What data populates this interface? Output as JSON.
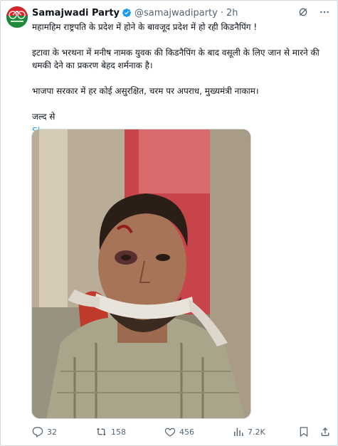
{
  "author": {
    "name": "Samajwadi Party",
    "handle": "@samajwadiparty",
    "separator": "·",
    "time": "2h",
    "avatar_icon": "samajwadi-cycle-logo",
    "verified_icon": "verified-badge-icon"
  },
  "tweet": {
    "line1": "महामहिम राष्ट्रपति के प्रदेश में होने के बावजूद प्रदेश में हो रही किडनैपिंग !",
    "line2": "इटावा के भरथना में मनीष नामक युवक की किडनैपिंग के बाद वसूली के लिए जान से मारने की धमकी देने का प्रकरण बेहद शर्मनाक है।",
    "line3": "भाजपा सरकार में हर कोई असुरक्षित, चरम पर अपराध, मुख्यमंत्री नाकाम।",
    "line4": "जल्द से",
    "show_more": "Show more"
  },
  "media": {
    "description_icon": "photo-injured-man-gagged"
  },
  "actions": {
    "replies": "32",
    "reposts": "158",
    "likes": "456",
    "views": "7.2K"
  },
  "colors": {
    "link": "#1d9bf0",
    "secondary": "#536471",
    "verified": "#1d9bf0",
    "avatar_bg": "#1a7a3a"
  }
}
